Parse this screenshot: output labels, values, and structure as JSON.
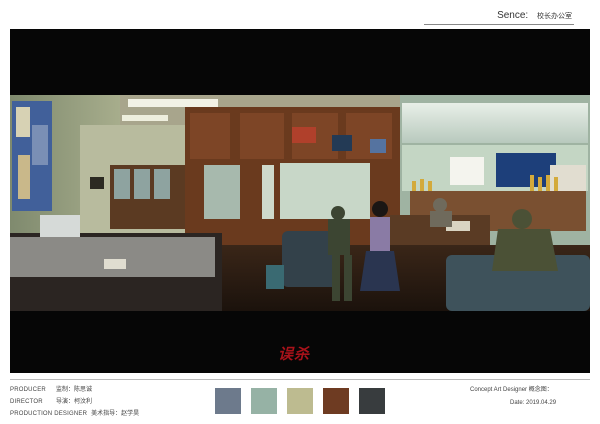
{
  "scene": {
    "label": "Sence:",
    "value": "校长办公室"
  },
  "logo_text": "误杀",
  "credits": [
    {
      "key": "PRODUCER",
      "value": "监制：陈思诚"
    },
    {
      "key": "DIRECTOR",
      "value": "导演：柯汶利"
    },
    {
      "key": "PRODUCTION DESIGNER",
      "value": "美术指导：赵学昊"
    }
  ],
  "palette": [
    "#6d7a8c",
    "#96b2a5",
    "#bdbb90",
    "#6e3b22",
    "#383c3e"
  ],
  "concept_artist": "Concept Art Designer 概念图：",
  "date": "Date:  2019.04.29"
}
